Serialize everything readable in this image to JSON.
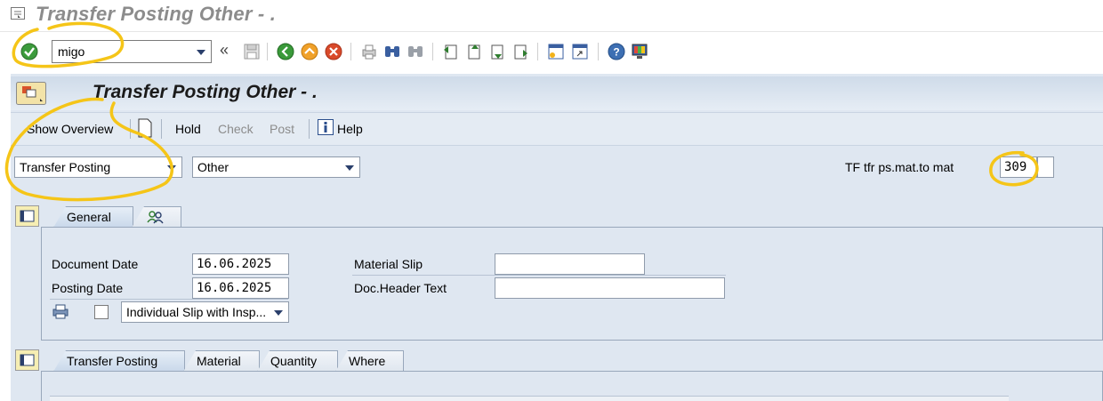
{
  "window": {
    "title": "Transfer Posting Other - ."
  },
  "toolbar": {
    "command_value": "migo",
    "icons": [
      "enter-icon",
      "back-nav-icon",
      "save-icon",
      "back-icon",
      "exit-icon",
      "cancel-icon",
      "print-icon",
      "find-icon",
      "find-next-icon",
      "first-page-icon",
      "previous-page-icon",
      "next-page-icon",
      "last-page-icon",
      "create-session-icon",
      "shortcut-icon",
      "help-icon",
      "customize-layout-icon"
    ]
  },
  "app": {
    "title": "Transfer Posting Other - .",
    "toolbar": {
      "show_overview": "Show Overview",
      "hold": "Hold",
      "check": "Check",
      "post": "Post",
      "help": "Help"
    },
    "action_select": "Transfer Posting",
    "ref_select": "Other",
    "movement_type_label": "TF tfr ps.mat.to mat",
    "movement_type_value": "309"
  },
  "header_tabs": {
    "tabs": [
      "General",
      ""
    ],
    "active": "General"
  },
  "general": {
    "document_date_label": "Document Date",
    "document_date_value": "16.06.2025",
    "posting_date_label": "Posting Date",
    "posting_date_value": "16.06.2025",
    "material_slip_label": "Material Slip",
    "material_slip_value": "",
    "doc_header_text_label": "Doc.Header Text",
    "doc_header_text_value": "",
    "print_version_value": "Individual Slip with Insp..."
  },
  "item_tabs": {
    "tabs": [
      "Transfer Posting",
      "Material",
      "Quantity",
      "Where"
    ],
    "active": "Transfer Posting"
  },
  "colors": {
    "annotation": "#f5c518",
    "accent": "#2a3f6b"
  }
}
